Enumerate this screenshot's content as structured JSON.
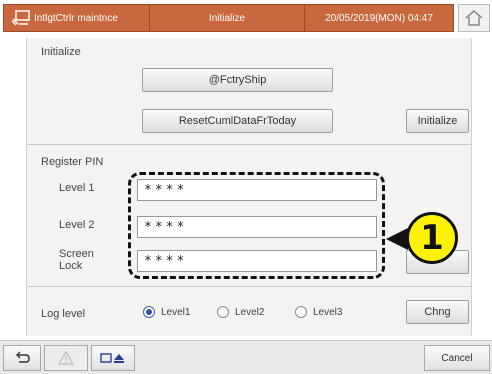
{
  "header": {
    "app_title": "IntlgtCtrlr maintnce",
    "screen_title": "Initialize",
    "datetime": "20/05/2019(MON) 04:47",
    "tool_icon": "maintenance-tool-icon",
    "home_icon": "home-icon"
  },
  "initialize": {
    "section_title": "Initialize",
    "factory_ship_label": "@FctryShip",
    "reset_label": "ResetCumlDataFrToday",
    "initialize_label": "Initialize"
  },
  "register_pin": {
    "section_title": "Register PIN",
    "fields": [
      {
        "label": "Level 1",
        "value": "****"
      },
      {
        "label": "Level 2",
        "value": "****"
      },
      {
        "label": "Screen Lock",
        "value": "****"
      }
    ]
  },
  "log_level": {
    "label": "Log level",
    "options": [
      "Level1",
      "Level2",
      "Level3"
    ],
    "selected": "Level1",
    "change_label": "Chng"
  },
  "annotation": {
    "callout_number": "1"
  },
  "footer": {
    "back_icon": "back-arrow-icon",
    "warning_icon": "warning-icon",
    "eject_icon": "media-eject-icon",
    "cancel_label": "Cancel"
  },
  "colors": {
    "header_accent": "#c9683f",
    "callout_yellow": "#fff200",
    "radio_selected": "#2b55b8"
  }
}
